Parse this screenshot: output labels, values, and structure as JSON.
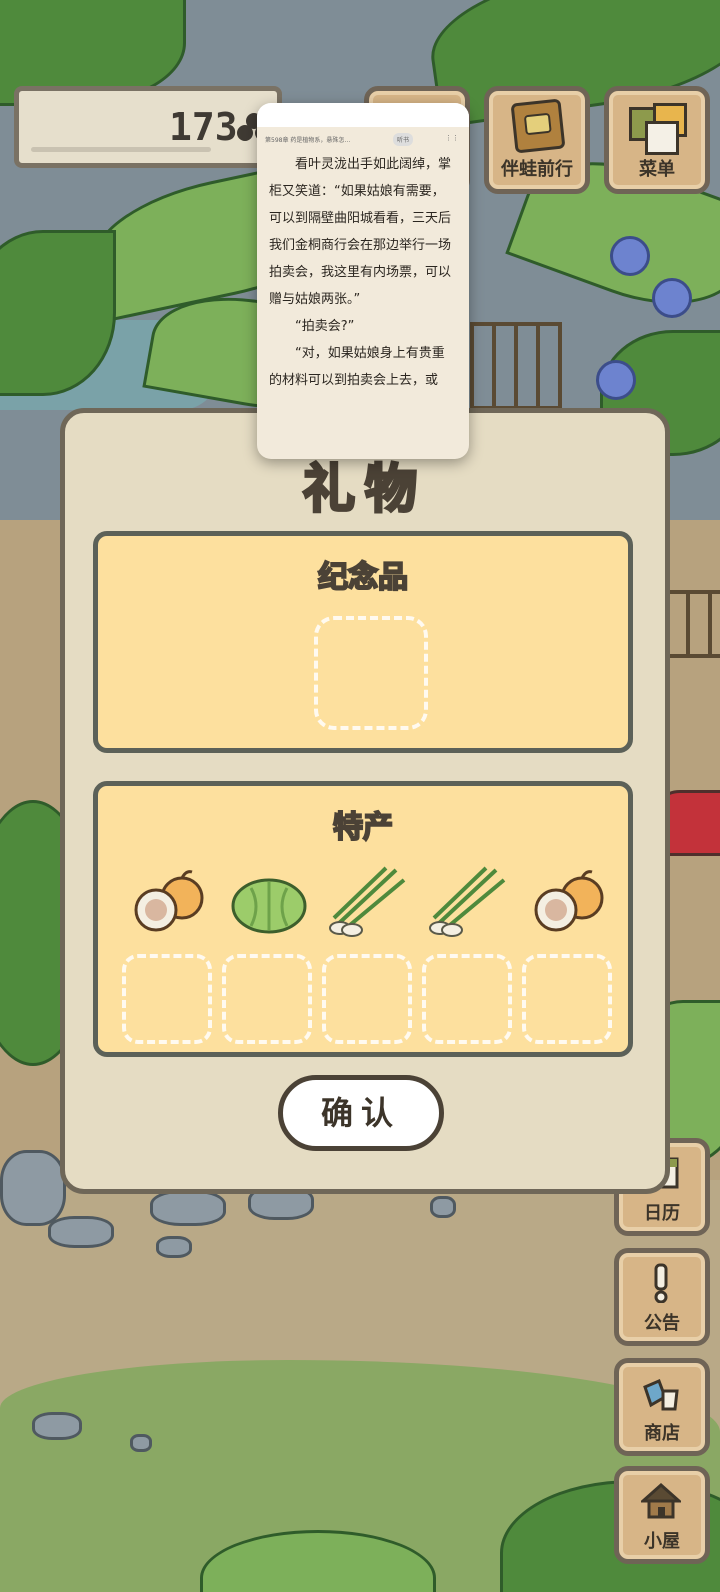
{
  "hud": {
    "clover_count": "173",
    "travel_label": "伴蛙前行",
    "menu_label": "菜单"
  },
  "reader": {
    "chapter": "第598章 药是植物系，悬殊怎…",
    "listen": "听书",
    "paragraphs": [
      "看叶灵泷出手如此阔绰，掌柜又笑道：“如果姑娘有需要，可以到隔壁曲阳城看看，三天后我们金桐商行会在那边举行一场拍卖会，我这里有内场票，可以赠与姑娘两张。”",
      "“拍卖会?”",
      "“对，如果姑娘身上有贵重的材料可以到拍卖会上去，或"
    ]
  },
  "dialog": {
    "title": "礼物",
    "souvenir_title": "纪念品",
    "specialty_title": "特产",
    "specialty_items": [
      "melon-icon",
      "cabbage-icon",
      "scallion-icon",
      "scallion-icon",
      "melon-icon"
    ],
    "confirm_label": "确认"
  },
  "side_menu": {
    "calendar_label": "日历",
    "notice_label": "公告",
    "shop_label": "商店",
    "house_label": "小屋"
  },
  "colors": {
    "panel": "#fde09e",
    "dialog": "#e5dcc3",
    "wood": "#d7b587"
  }
}
